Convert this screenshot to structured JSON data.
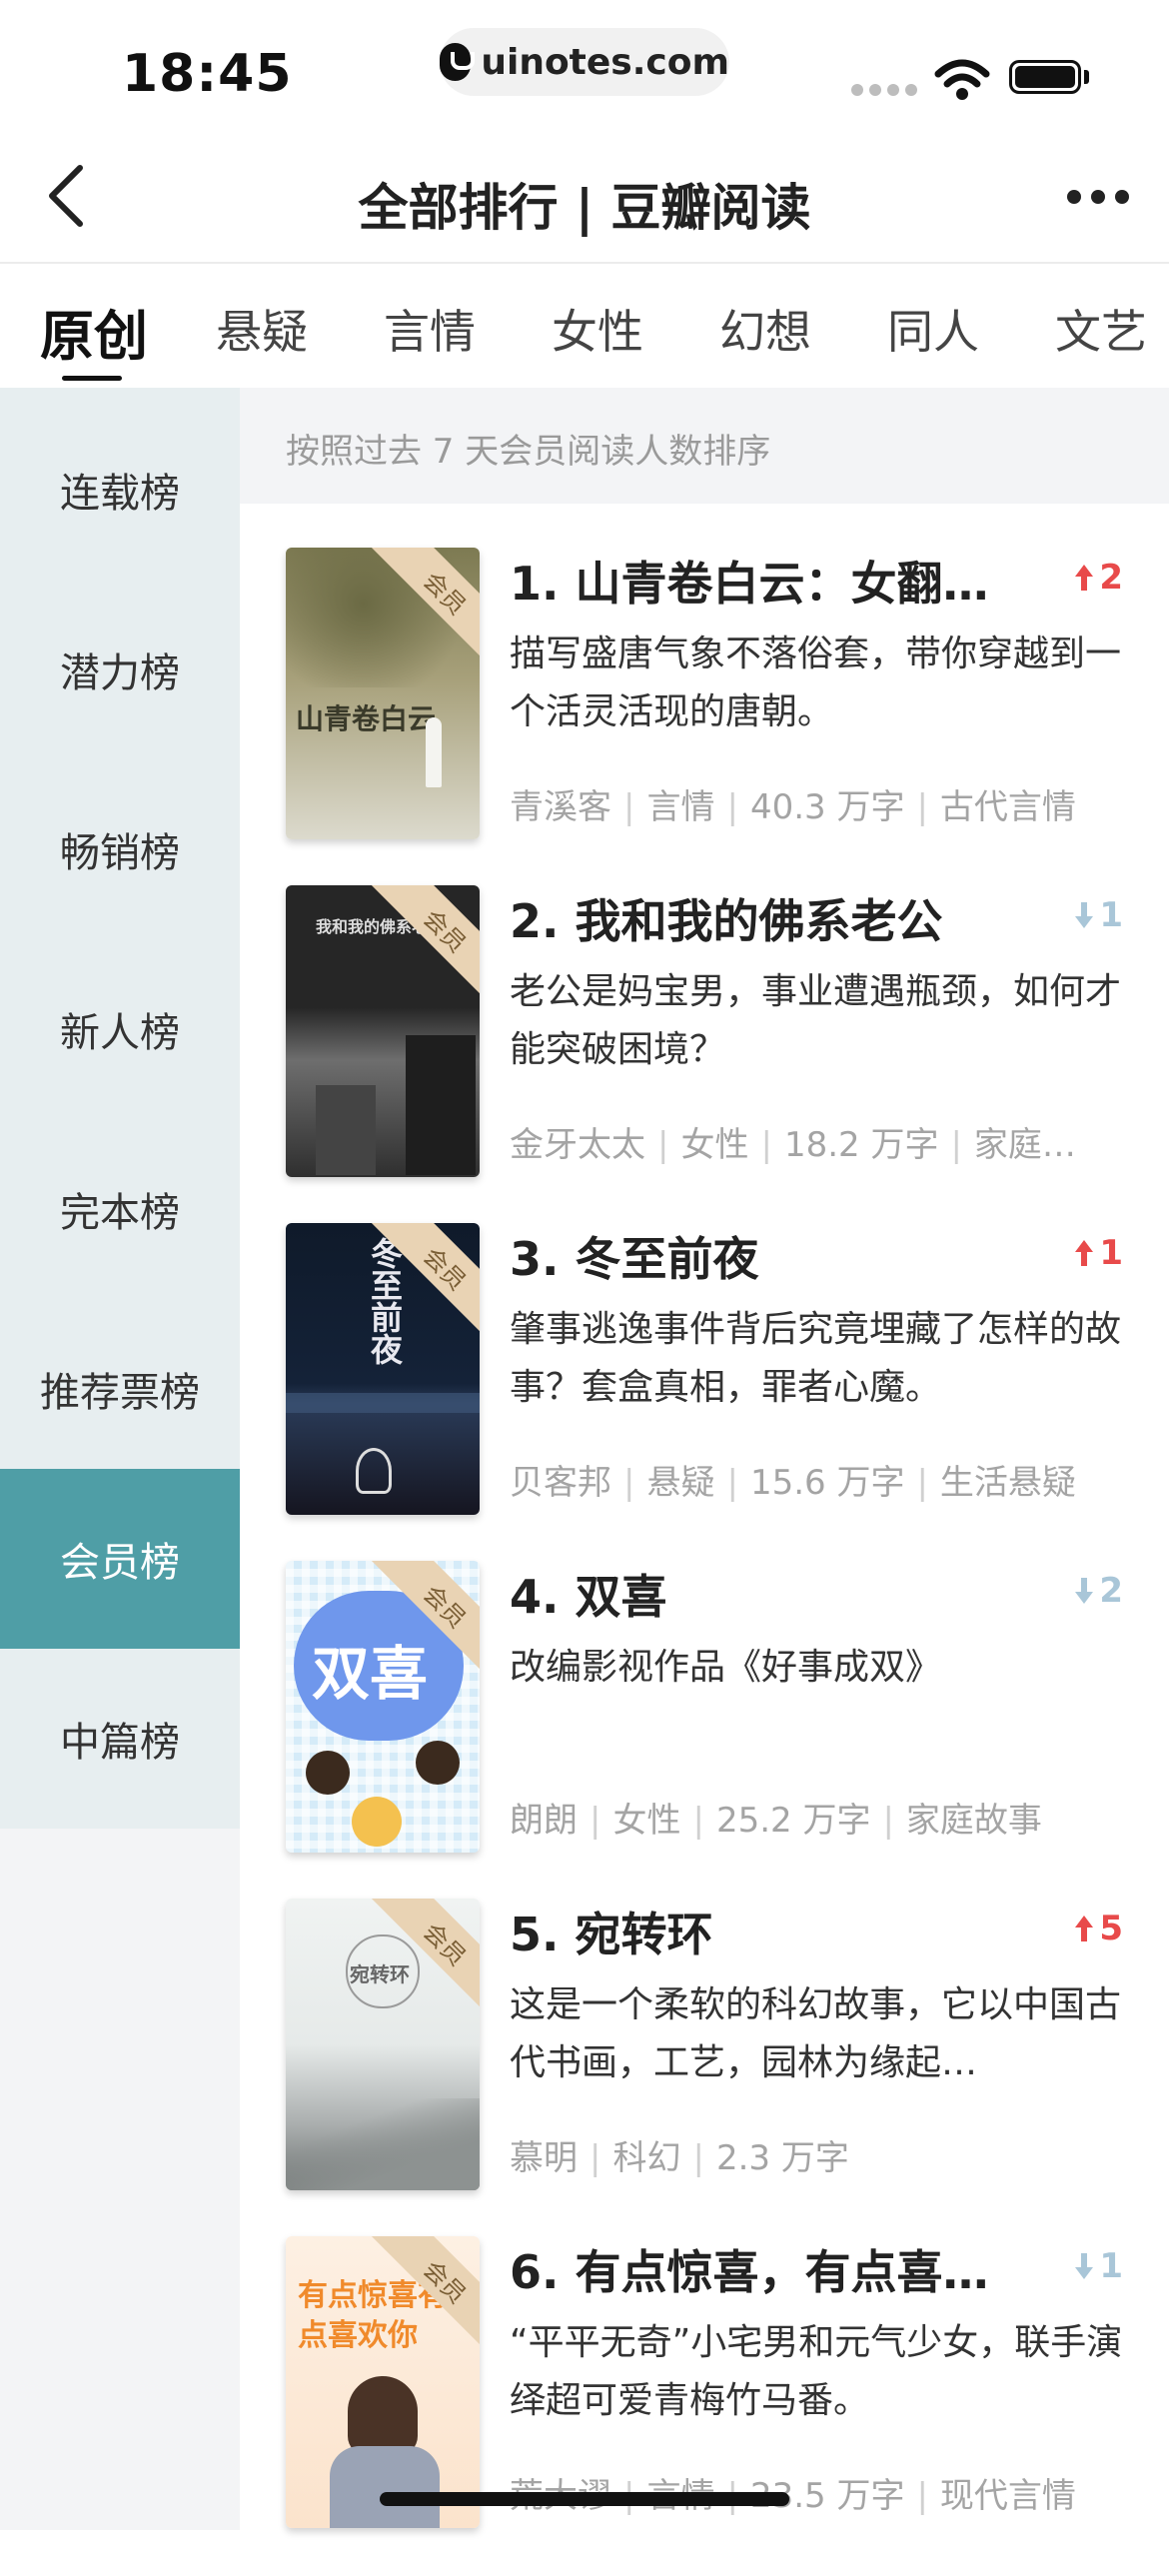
{
  "status": {
    "time": "18:45",
    "url": "uinotes.com"
  },
  "nav": {
    "title": "全部排行 | 豆瓣阅读"
  },
  "tabs": [
    "原创",
    "悬疑",
    "言情",
    "女性",
    "幻想",
    "同人",
    "文艺"
  ],
  "sidebar": [
    "连载榜",
    "潜力榜",
    "畅销榜",
    "新人榜",
    "完本榜",
    "推荐票榜",
    "会员榜",
    "中篇榜"
  ],
  "sidebar_active": "会员榜",
  "sort_note": "按照过去 7 天会员阅读人数排序",
  "member_badge": "会员",
  "books": [
    {
      "title": "1.  山青卷白云：女翻…",
      "change_dir": "up",
      "change": "2",
      "desc": "描写盛唐气象不落俗套，带你穿越到一个活灵活现的唐朝。",
      "author": "青溪客",
      "category": "言情",
      "words": "40.3 万字",
      "tag": "古代言情",
      "cover_text": "山青卷白云",
      "cover_colors": [
        "#8a8a5e",
        "#b9b08a",
        "#d8d6c8"
      ]
    },
    {
      "title": "2.  我和我的佛系老公",
      "change_dir": "down",
      "change": "1",
      "desc": "老公是妈宝男，事业遭遇瓶颈，如何才能突破困境？",
      "author": "金牙太太",
      "category": "女性",
      "words": "18.2 万字",
      "tag": "家庭…",
      "cover_text": "我和我的佛系老公",
      "cover_colors": [
        "#2b2b2b",
        "#555555",
        "#8e8e8e"
      ]
    },
    {
      "title": "3.  冬至前夜",
      "change_dir": "up",
      "change": "1",
      "desc": "肇事逃逸事件背后究竟埋藏了怎样的故事？套盒真相，罪者心魔。",
      "author": "贝客邦",
      "category": "悬疑",
      "words": "15.6 万字",
      "tag": "生活悬疑",
      "cover_text": "冬至前夜",
      "cover_colors": [
        "#0f1a2a",
        "#1e2f46",
        "#151520"
      ]
    },
    {
      "title": "4.  双喜",
      "change_dir": "down",
      "change": "2",
      "desc": "改编影视作品《好事成双》",
      "author": "朗朗",
      "category": "女性",
      "words": "25.2 万字",
      "tag": "家庭故事",
      "cover_text": "双喜",
      "cover_colors": [
        "#cfe6f7",
        "#5b8fe6",
        "#f4c14f"
      ]
    },
    {
      "title": "5.  宛转环",
      "change_dir": "up",
      "change": "5",
      "desc": "这是一个柔软的科幻故事，它以中国古代书画，工艺，园林为缘起…",
      "author": "慕明",
      "category": "科幻",
      "words": "2.3 万字",
      "tag": "",
      "cover_text": "宛转环",
      "cover_colors": [
        "#eef1f0",
        "#b8bcbc",
        "#7b807f"
      ]
    },
    {
      "title": "6.  有点惊喜，有点喜…",
      "change_dir": "down",
      "change": "1",
      "desc": "“平平无奇”小宅男和元气少女，联手演绎超可爱青梅竹马番。",
      "author": "荒大谬",
      "category": "言情",
      "words": "23.5 万字",
      "tag": "现代言情",
      "cover_text": "有点惊喜有点喜欢你",
      "cover_colors": [
        "#fde9d6",
        "#f08a2b",
        "#f6c9a4"
      ]
    }
  ]
}
